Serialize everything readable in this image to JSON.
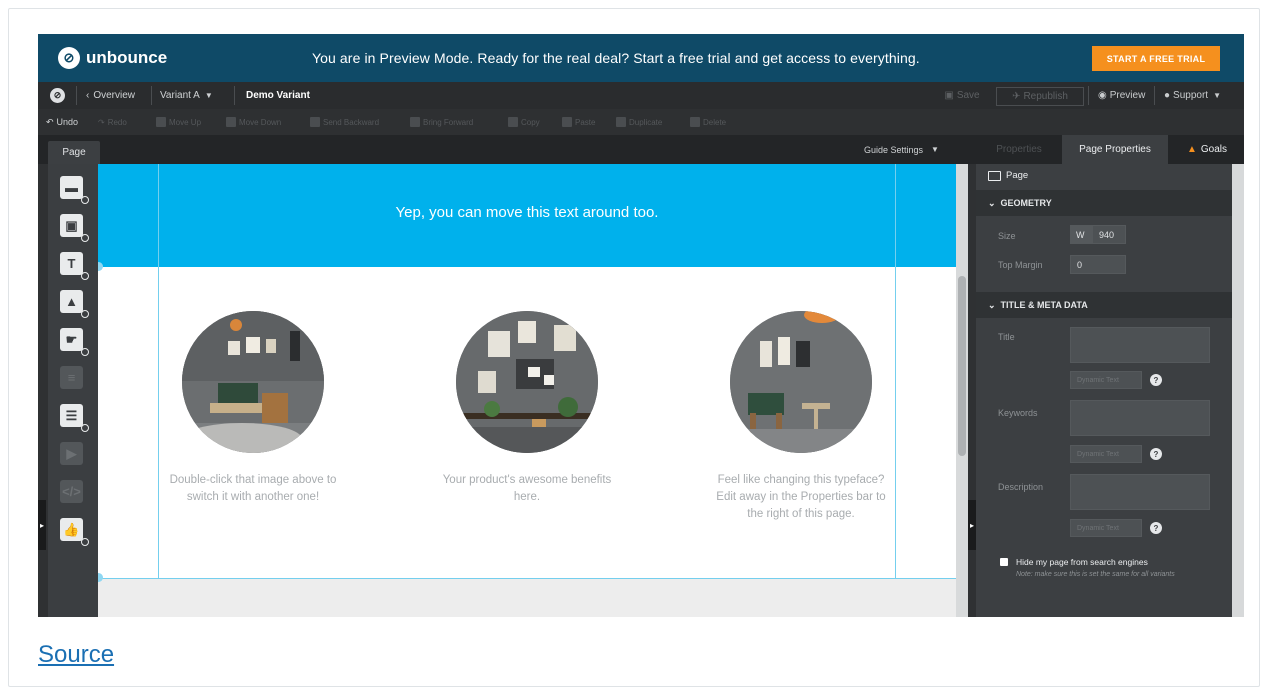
{
  "banner": {
    "brand": "unbounce",
    "message": "You are in Preview Mode. Ready for the real deal? Start a free trial and get access to everything.",
    "cta": "START A FREE TRIAL",
    "cta_color": "#f5901e",
    "bg_color": "#0f4a67"
  },
  "nav": {
    "overview": "Overview",
    "variant": "Variant A",
    "variant_name": "Demo Variant",
    "save": "Save",
    "republish": "Republish",
    "preview": "Preview",
    "support": "Support"
  },
  "toolbar": {
    "undo": "Undo",
    "redo": "Redo",
    "items": [
      "Move Up",
      "Move Down",
      "Send Backward",
      "Bring Forward",
      "Copy",
      "Paste",
      "Duplicate",
      "Delete"
    ]
  },
  "tabs": {
    "page": "Page",
    "guide_settings": "Guide Settings"
  },
  "canvas": {
    "header_text": "Yep, you can move this text around too.",
    "header_color": "#00b1ec",
    "columns": [
      {
        "text": "Double-click that image above to switch it with another one!"
      },
      {
        "text": "Your product's awesome benefits here."
      },
      {
        "text": "Feel like changing this typeface? Edit away in the Properties bar to the right of this page."
      }
    ]
  },
  "right_panel": {
    "tabs": {
      "properties": "Properties",
      "page_properties": "Page Properties",
      "goals": "Goals"
    },
    "page_label": "Page",
    "geometry": {
      "heading": "GEOMETRY",
      "size_label": "Size",
      "width_prefix": "W",
      "width_value": "940",
      "top_margin_label": "Top Margin",
      "top_margin_value": "0"
    },
    "meta": {
      "heading": "TITLE & META DATA",
      "title_label": "Title",
      "keywords_label": "Keywords",
      "description_label": "Description",
      "dynamic_text": "Dynamic Text"
    },
    "hide_label": "Hide my page from search engines",
    "hide_note": "Note: make sure this is set the same for all variants"
  },
  "source_link": "Source"
}
